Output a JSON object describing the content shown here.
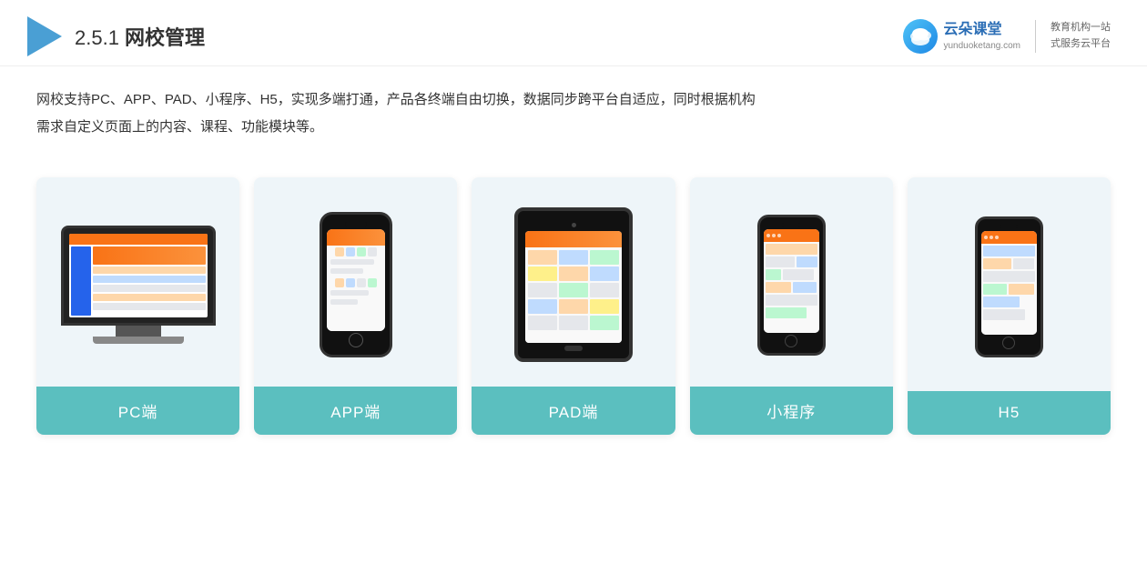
{
  "header": {
    "section_number": "2.5.1",
    "title_prefix": "2.5.1 ",
    "title": "网校管理",
    "logo": {
      "icon_text": "云朵",
      "name": "云朵课堂",
      "website": "yunduoketang.com",
      "slogan_line1": "教育机构一站",
      "slogan_line2": "式服务云平台"
    }
  },
  "description": {
    "line1": "网校支持PC、APP、PAD、小程序、H5，实现多端打通，产品各终端自由切换，数据同步跨平台自适应，同时根据机构",
    "line2": "需求自定义页面上的内容、课程、功能模块等。"
  },
  "cards": [
    {
      "id": "pc",
      "label": "PC端",
      "device": "pc"
    },
    {
      "id": "app",
      "label": "APP端",
      "device": "phone"
    },
    {
      "id": "pad",
      "label": "PAD端",
      "device": "pad"
    },
    {
      "id": "miniprogram",
      "label": "小程序",
      "device": "phone-sm"
    },
    {
      "id": "h5",
      "label": "H5",
      "device": "phone-sm"
    }
  ]
}
